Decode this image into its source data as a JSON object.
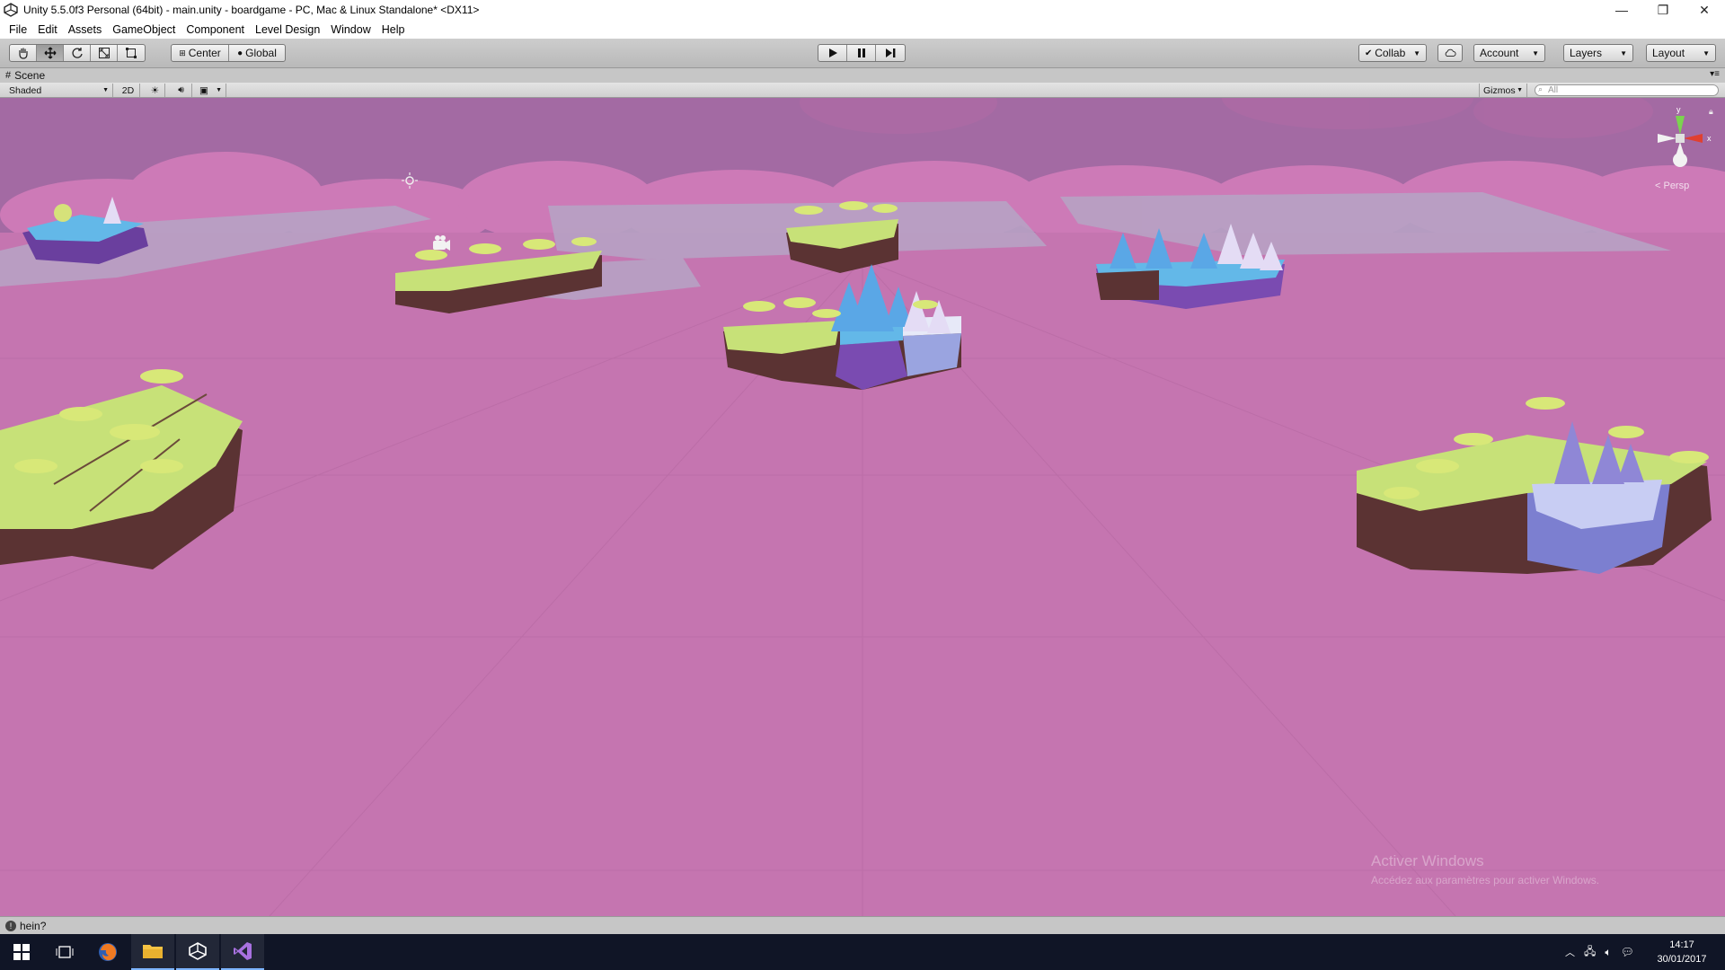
{
  "window": {
    "title": "Unity 5.5.0f3 Personal (64bit) - main.unity - boardgame - PC, Mac & Linux Standalone* <DX11>",
    "minimize": "—",
    "restore": "❐",
    "close": "✕"
  },
  "menu": {
    "items": [
      "File",
      "Edit",
      "Assets",
      "GameObject",
      "Component",
      "Level Design",
      "Window",
      "Help"
    ]
  },
  "toolbar": {
    "pivot_label": "Center",
    "space_label": "Global",
    "collab_label": "Collab",
    "account_label": "Account",
    "layers_label": "Layers",
    "layout_label": "Layout"
  },
  "scene": {
    "tab_label": "Scene",
    "shading_mode": "Shaded",
    "mode_2d": "2D",
    "gizmos_label": "Gizmos",
    "search_placeholder": "All",
    "persp_label": "< Persp",
    "gizmo_axes": {
      "y": "y",
      "x": "x"
    }
  },
  "status": {
    "message": "hein?"
  },
  "watermark": {
    "line1": "Activer Windows",
    "line2": "Accédez aux paramètres pour activer Windows."
  },
  "taskbar": {
    "time": "14:17",
    "date": "30/01/2017"
  },
  "colors": {
    "sky": "#a36aa3",
    "ground": "#c575b0",
    "accent_blue": "#5aa7e6"
  }
}
